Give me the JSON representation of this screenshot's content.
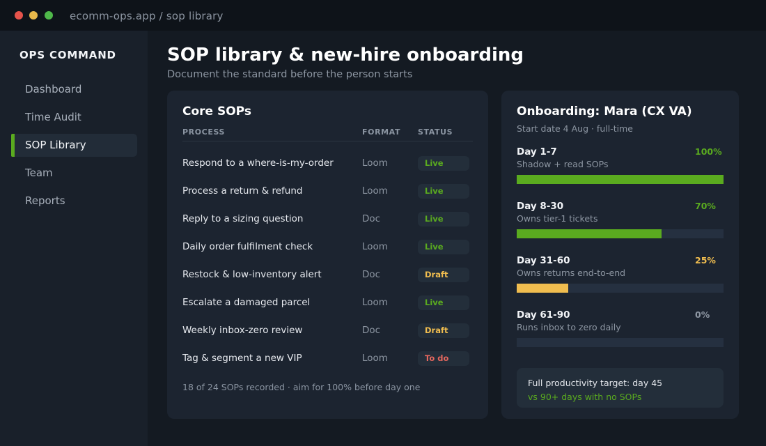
{
  "window": {
    "title": "ecomm-ops.app / sop library"
  },
  "sidebar": {
    "brand": "OPS COMMAND",
    "items": [
      {
        "label": "Dashboard",
        "active": false
      },
      {
        "label": "Time Audit",
        "active": false
      },
      {
        "label": "SOP Library",
        "active": true
      },
      {
        "label": "Team",
        "active": false
      },
      {
        "label": "Reports",
        "active": false
      }
    ]
  },
  "header": {
    "title": "SOP library & new-hire onboarding",
    "subtitle": "Document the standard before the person starts"
  },
  "sops": {
    "title": "Core SOPs",
    "columns": [
      "PROCESS",
      "FORMAT",
      "STATUS"
    ],
    "rows": [
      {
        "process": "Respond to a where-is-my-order",
        "format": "Loom",
        "status": "Live"
      },
      {
        "process": "Process a return & refund",
        "format": "Loom",
        "status": "Live"
      },
      {
        "process": "Reply to a sizing question",
        "format": "Doc",
        "status": "Live"
      },
      {
        "process": "Daily order fulfilment check",
        "format": "Loom",
        "status": "Live"
      },
      {
        "process": "Restock & low-inventory alert",
        "format": "Doc",
        "status": "Draft"
      },
      {
        "process": "Escalate a damaged parcel",
        "format": "Loom",
        "status": "Live"
      },
      {
        "process": "Weekly inbox-zero review",
        "format": "Doc",
        "status": "Draft"
      },
      {
        "process": "Tag & segment a new VIP",
        "format": "Loom",
        "status": "To do"
      }
    ],
    "footer": "18 of 24 SOPs recorded  ·  aim for 100% before day one"
  },
  "onboarding": {
    "title": "Onboarding: Mara (CX VA)",
    "meta": "Start date 4 Aug  ·  full-time",
    "phases": [
      {
        "label": "Day 1-7",
        "desc": "Shadow + read SOPs",
        "pct_text": "100%",
        "pct": 100,
        "color": "#5aab1f"
      },
      {
        "label": "Day 8-30",
        "desc": "Owns tier-1 tickets",
        "pct_text": "70%",
        "pct": 70,
        "color": "#5aab1f"
      },
      {
        "label": "Day 31-60",
        "desc": "Owns returns end-to-end",
        "pct_text": "25%",
        "pct": 25,
        "color": "#f0bd4f"
      },
      {
        "label": "Day 61-90",
        "desc": "Runs inbox to zero daily",
        "pct_text": "0%",
        "pct": 0,
        "color": "#8d96a2"
      }
    ],
    "target": "Full productivity target: day 45",
    "target_sub": "vs 90+ days with no SOPs"
  },
  "colors": {
    "accent": "#5aab1f",
    "draft": "#f0bd4f",
    "todo": "#e5675e"
  }
}
